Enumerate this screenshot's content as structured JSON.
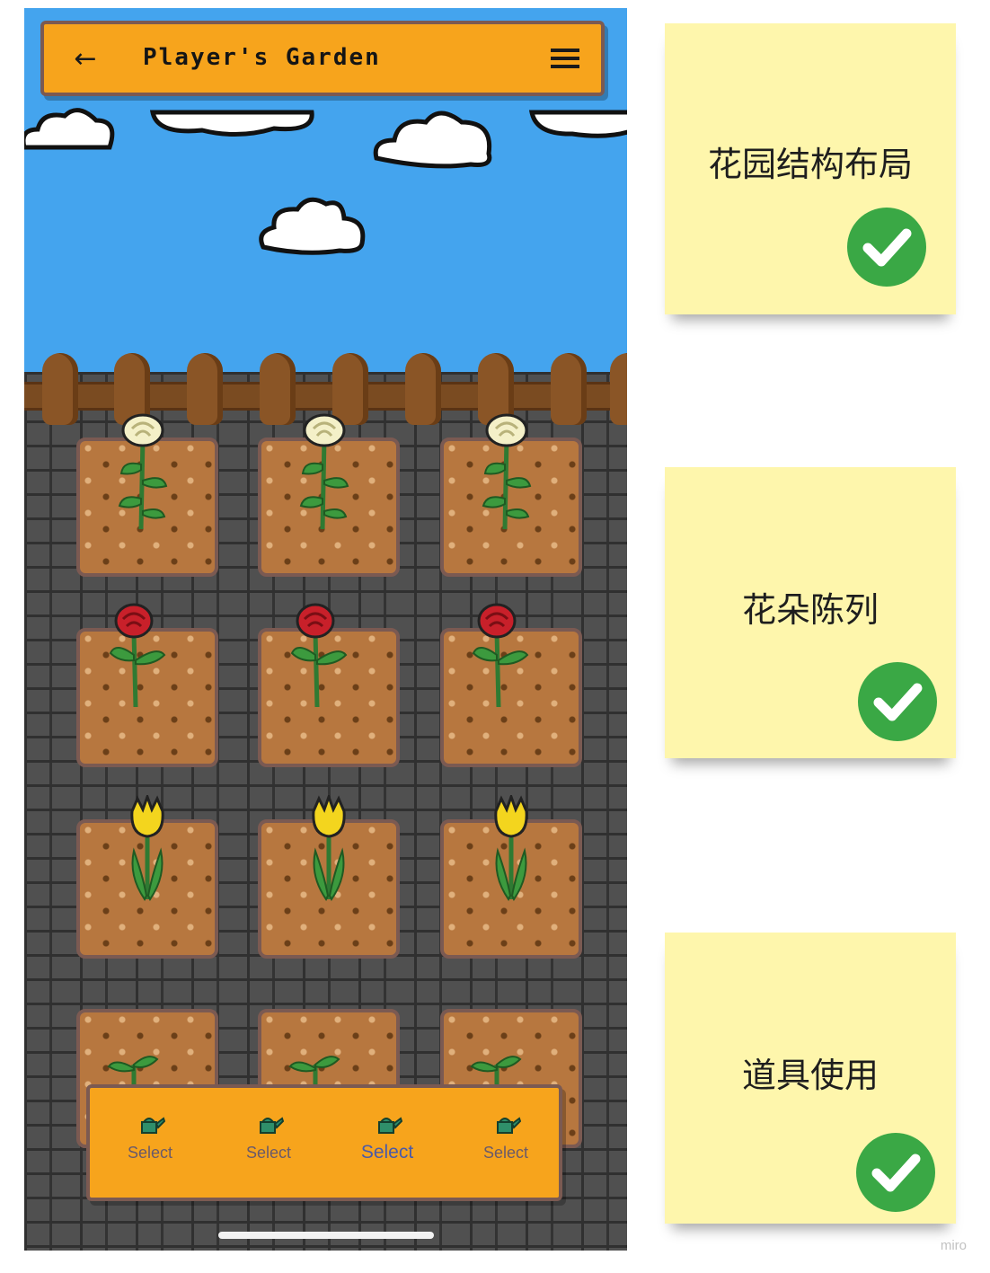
{
  "app_bar": {
    "back_icon": "arrow-left-icon",
    "title": "Player's Garden",
    "menu_icon": "hamburger-menu-icon",
    "background_color": "#f7a41c"
  },
  "garden": {
    "rows": [
      {
        "flower": "white rose"
      },
      {
        "flower": "red rose"
      },
      {
        "flower": "yellow tulip"
      },
      {
        "flower": "sprout"
      }
    ]
  },
  "toolbar": {
    "items": [
      {
        "label": "Select",
        "icon": "watering-can-icon"
      },
      {
        "label": "Select",
        "icon": "watering-can-icon"
      },
      {
        "label": "Select",
        "icon": "watering-can-icon",
        "active": true
      },
      {
        "label": "Select",
        "icon": "watering-can-icon"
      }
    ]
  },
  "notes": [
    {
      "text": "花园结构布局",
      "icon": "check-circle-icon"
    },
    {
      "text": "花朵陈列",
      "icon": "check-circle-icon"
    },
    {
      "text": "道具使用",
      "icon": "check-circle-icon"
    }
  ],
  "watermark": "miro",
  "colors": {
    "sky": "#44a4ee",
    "soil": "#b7773f",
    "note": "#fef6ac",
    "check": "#3aa845"
  }
}
